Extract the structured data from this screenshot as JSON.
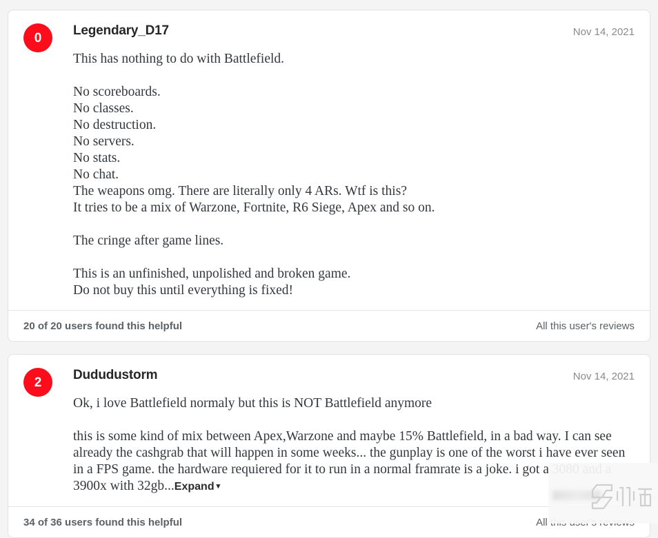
{
  "page": {
    "background_color": "#f4f4f4",
    "card_background": "#ffffff",
    "badge_color": "#fc0d1b",
    "muted_text_color": "#8a8a8a"
  },
  "reviews": [
    {
      "score": "0",
      "username": "Legendary_D17",
      "date": "Nov 14, 2021",
      "body": "This has nothing to do with Battlefield.\n\nNo scoreboards.\nNo classes.\nNo destruction.\nNo servers.\nNo stats.\nNo chat.\nThe weapons omg. There are literally only 4 ARs. Wtf is this?\nIt tries to be a mix of Warzone, Fortnite, R6 Siege, Apex and so on.\n\nThe cringe after game lines.\n\nThis is an unfinished, unpolished and broken game.\nDo not buy this until everything is fixed!",
      "helpful": "20 of 20 users found this helpful",
      "all_reviews_label": "All this user's reviews",
      "expandable": false
    },
    {
      "score": "2",
      "username": "Dududustorm",
      "date": "Nov 14, 2021",
      "body": "Ok, i love Battlefield normaly but this is NOT Battlefield anymore\n\nthis is some kind of mix between Apex,Warzone and maybe 15% Battlefield, in a bad way. I can see already the cashgrab that will happen in some weeks... the gunplay is one of the worst i have ever seen in a FPS game. the hardware requiered for it to run in a normal framrate is a joke. i got a 3080 and a 3900x with 32gb...",
      "helpful": "34 of 36 users found this helpful",
      "all_reviews_label": "All this user's reviews",
      "expandable": true,
      "expand_label": "Expand",
      "expand_caret": "▾"
    }
  ],
  "watermark": {
    "text": "九游"
  }
}
